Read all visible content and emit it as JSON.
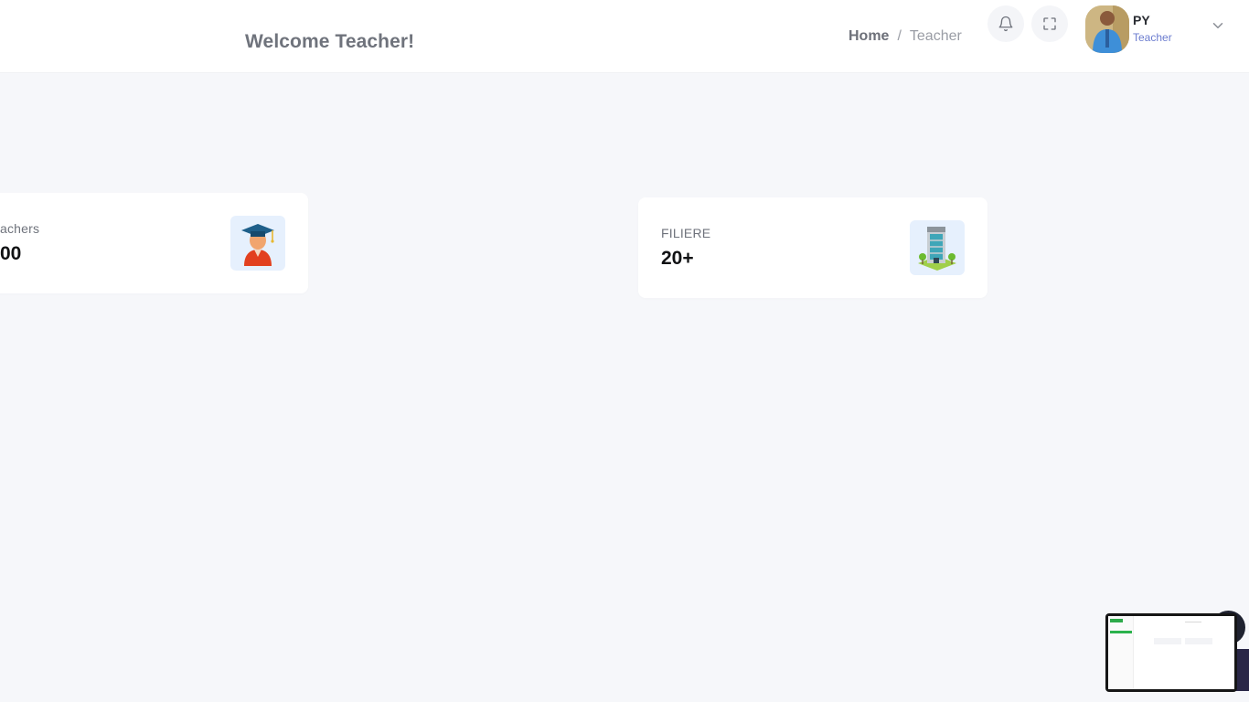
{
  "header": {
    "welcome": "Welcome Teacher!",
    "breadcrumb": {
      "home": "Home",
      "separator": "/",
      "current": "Teacher"
    },
    "icons": {
      "notifications": "bell-icon",
      "fullscreen": "expand-icon",
      "user_menu": "chevron-down-icon"
    }
  },
  "user": {
    "name": "PY",
    "role": "Teacher"
  },
  "cards": [
    {
      "label": "achers",
      "value": "00",
      "icon": "graduate-student-icon"
    },
    {
      "label": "FILIERE",
      "value": "20+",
      "icon": "building-icon"
    }
  ],
  "colors": {
    "background": "#f6f7fa",
    "card": "#ffffff",
    "icon_tile": "#e6f0fd",
    "role_text": "#6b7ccf",
    "muted_text": "#6f737c"
  }
}
